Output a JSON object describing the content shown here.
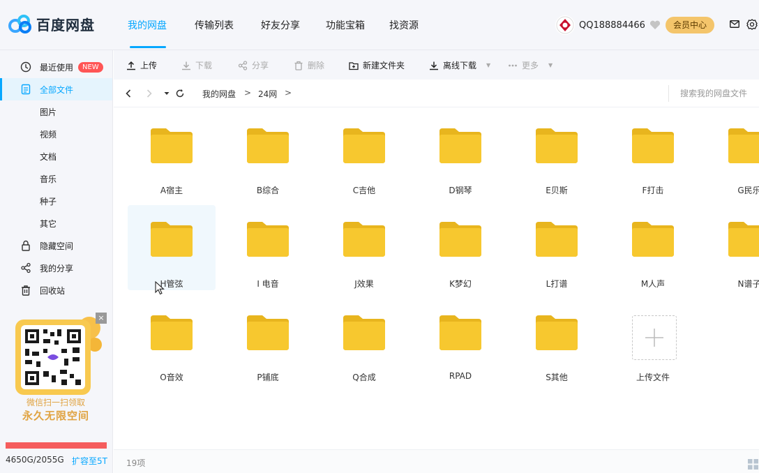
{
  "app": {
    "name": "百度网盘"
  },
  "nav": {
    "tabs": [
      {
        "label": "我的网盘"
      },
      {
        "label": "传输列表"
      },
      {
        "label": "好友分享"
      },
      {
        "label": "功能宝箱"
      },
      {
        "label": "找资源"
      }
    ],
    "active_tab": "我的网盘"
  },
  "user": {
    "name": "QQ188884466",
    "vip_button": "会员中心"
  },
  "sidebar": {
    "items": [
      {
        "label": "最近使用",
        "icon": "clock-icon",
        "badge": "NEW"
      },
      {
        "label": "全部文件",
        "icon": "file-icon",
        "active": true
      },
      {
        "label": "图片"
      },
      {
        "label": "视频"
      },
      {
        "label": "文档"
      },
      {
        "label": "音乐"
      },
      {
        "label": "种子"
      },
      {
        "label": "其它"
      },
      {
        "label": "隐藏空间",
        "icon": "lock-icon"
      },
      {
        "label": "我的分享",
        "icon": "share-icon"
      },
      {
        "label": "回收站",
        "icon": "trash-icon"
      }
    ],
    "promo": {
      "line1": "微信扫一扫领取",
      "line2": "永久无限空间",
      "close": "×"
    },
    "quota": {
      "text": "4650G/2055G",
      "expand_label": "扩容至5T",
      "color": "#f55d5d"
    }
  },
  "toolbar": {
    "upload": "上传",
    "download": "下载",
    "share": "分享",
    "delete": "删除",
    "new_folder": "新建文件夹",
    "offline_download": "离线下载",
    "more": "更多"
  },
  "breadcrumb": {
    "path": [
      "我的网盘",
      "24网"
    ],
    "separator": ">",
    "search_placeholder": "搜索我的网盘文件"
  },
  "folders": [
    {
      "name": "A宿主"
    },
    {
      "name": "B综合"
    },
    {
      "name": "C吉他"
    },
    {
      "name": "D钢琴"
    },
    {
      "name": "E贝斯"
    },
    {
      "name": "F打击"
    },
    {
      "name": "G民乐"
    },
    {
      "name": "H管弦"
    },
    {
      "name": "I 电音"
    },
    {
      "name": "J效果"
    },
    {
      "name": "K梦幻"
    },
    {
      "name": "L打谱"
    },
    {
      "name": "M人声"
    },
    {
      "name": "N谱子"
    },
    {
      "name": "O音效"
    },
    {
      "name": "P铺底"
    },
    {
      "name": "Q合成"
    },
    {
      "name": "RPAD"
    },
    {
      "name": "S其他"
    }
  ],
  "upload_tile": {
    "label": "上传文件"
  },
  "footer": {
    "count": "19项"
  },
  "colors": {
    "accent": "#06a7ff",
    "folder": "#f7c82f",
    "folder_tab": "#e8b51e",
    "vip": "#f4c56b"
  }
}
